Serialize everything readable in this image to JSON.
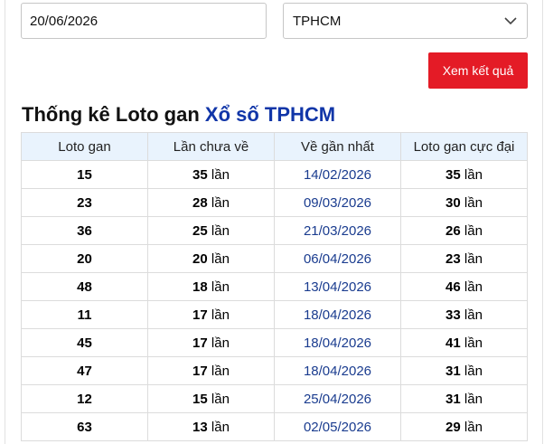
{
  "form": {
    "date_value": "20/06/2026",
    "province_value": "TPHCM",
    "submit_label": "Xem kết quả"
  },
  "heading": {
    "prefix": "Thống kê Loto gan",
    "accent": "Xổ số TPHCM"
  },
  "table": {
    "headers": [
      "Loto gan",
      "Lần chưa về",
      "Về gần nhất",
      "Loto gan cực đại"
    ],
    "unit": "lần",
    "rows": [
      {
        "loto": "15",
        "missing": "35",
        "last": "14/02/2026",
        "max": "35"
      },
      {
        "loto": "23",
        "missing": "28",
        "last": "09/03/2026",
        "max": "30"
      },
      {
        "loto": "36",
        "missing": "25",
        "last": "21/03/2026",
        "max": "26"
      },
      {
        "loto": "20",
        "missing": "20",
        "last": "06/04/2026",
        "max": "23"
      },
      {
        "loto": "48",
        "missing": "18",
        "last": "13/04/2026",
        "max": "46"
      },
      {
        "loto": "11",
        "missing": "17",
        "last": "18/04/2026",
        "max": "33"
      },
      {
        "loto": "45",
        "missing": "17",
        "last": "18/04/2026",
        "max": "41"
      },
      {
        "loto": "47",
        "missing": "17",
        "last": "18/04/2026",
        "max": "31"
      },
      {
        "loto": "12",
        "missing": "15",
        "last": "25/04/2026",
        "max": "31"
      },
      {
        "loto": "63",
        "missing": "13",
        "last": "02/05/2026",
        "max": "29"
      }
    ]
  },
  "colors": {
    "button": "#e41b26",
    "accent_text": "#1136a8",
    "header_bg": "#e9f3fd",
    "date_text": "#1a3c8f"
  },
  "icons": {
    "select_arrow": "chevron-down-icon"
  }
}
